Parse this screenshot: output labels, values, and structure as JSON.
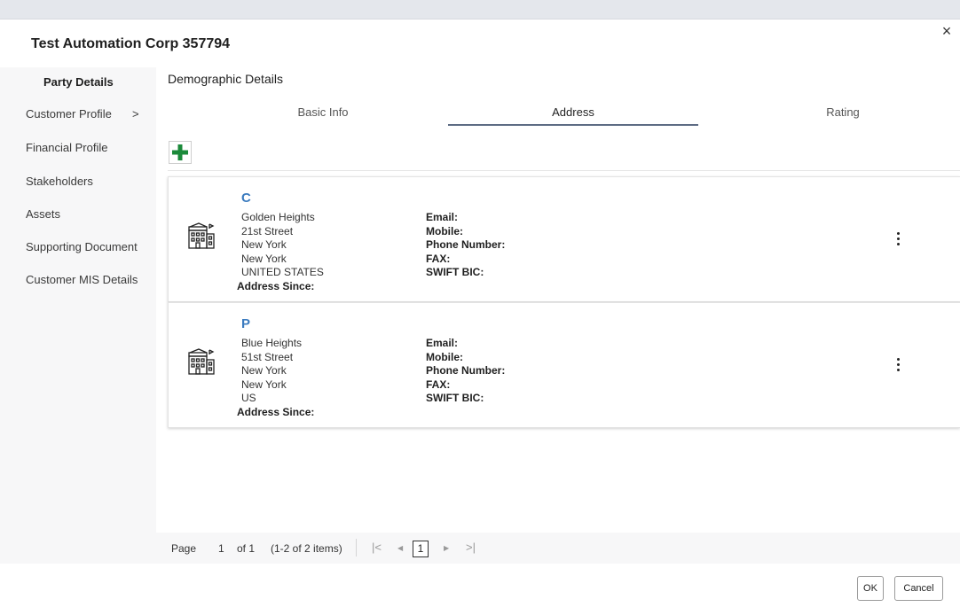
{
  "modal": {
    "title": "Test Automation Corp 357794",
    "close_glyph": "×"
  },
  "sidebar": {
    "items": [
      {
        "label": "Party Details",
        "active": true
      },
      {
        "label": "Customer Profile",
        "chevron": ">"
      },
      {
        "label": "Financial Profile"
      },
      {
        "label": "Stakeholders"
      },
      {
        "label": "Assets"
      },
      {
        "label": "Supporting Document"
      },
      {
        "label": "Customer MIS Details"
      }
    ]
  },
  "main": {
    "section_title": "Demographic Details",
    "tabs": [
      {
        "label": "Basic Info"
      },
      {
        "label": "Address",
        "active": true
      },
      {
        "label": "Rating"
      }
    ],
    "add_icon": "plus-icon",
    "addresses": [
      {
        "type": "C",
        "lines": [
          "Golden Heights",
          "21st Street",
          "New York",
          "New York",
          "UNITED STATES"
        ],
        "since_label": "Address Since:",
        "contacts": [
          "Email:",
          "Mobile:",
          "Phone Number:",
          "FAX:",
          "SWIFT BIC:"
        ],
        "icon": "building-icon"
      },
      {
        "type": "P",
        "lines": [
          "Blue Heights",
          "51st Street",
          "New York",
          "New York",
          "US"
        ],
        "since_label": "Address Since:",
        "contacts": [
          "Email:",
          "Mobile:",
          "Phone Number:",
          "FAX:",
          "SWIFT BIC:"
        ],
        "icon": "building-icon"
      }
    ]
  },
  "pager": {
    "page_label": "Page",
    "current": "1",
    "of_label": "of 1",
    "items_label": "(1-2 of 2 items)",
    "first": "|<",
    "prev": "◀",
    "next": "▶",
    "last": ">|",
    "page_number": "1"
  },
  "footer": {
    "ok_label": "OK",
    "cancel_label": "Cancel"
  },
  "colors": {
    "accent_green": "#1b8a3a",
    "type_blue": "#3b7bbf",
    "tab_underline": "#5e6c84"
  }
}
